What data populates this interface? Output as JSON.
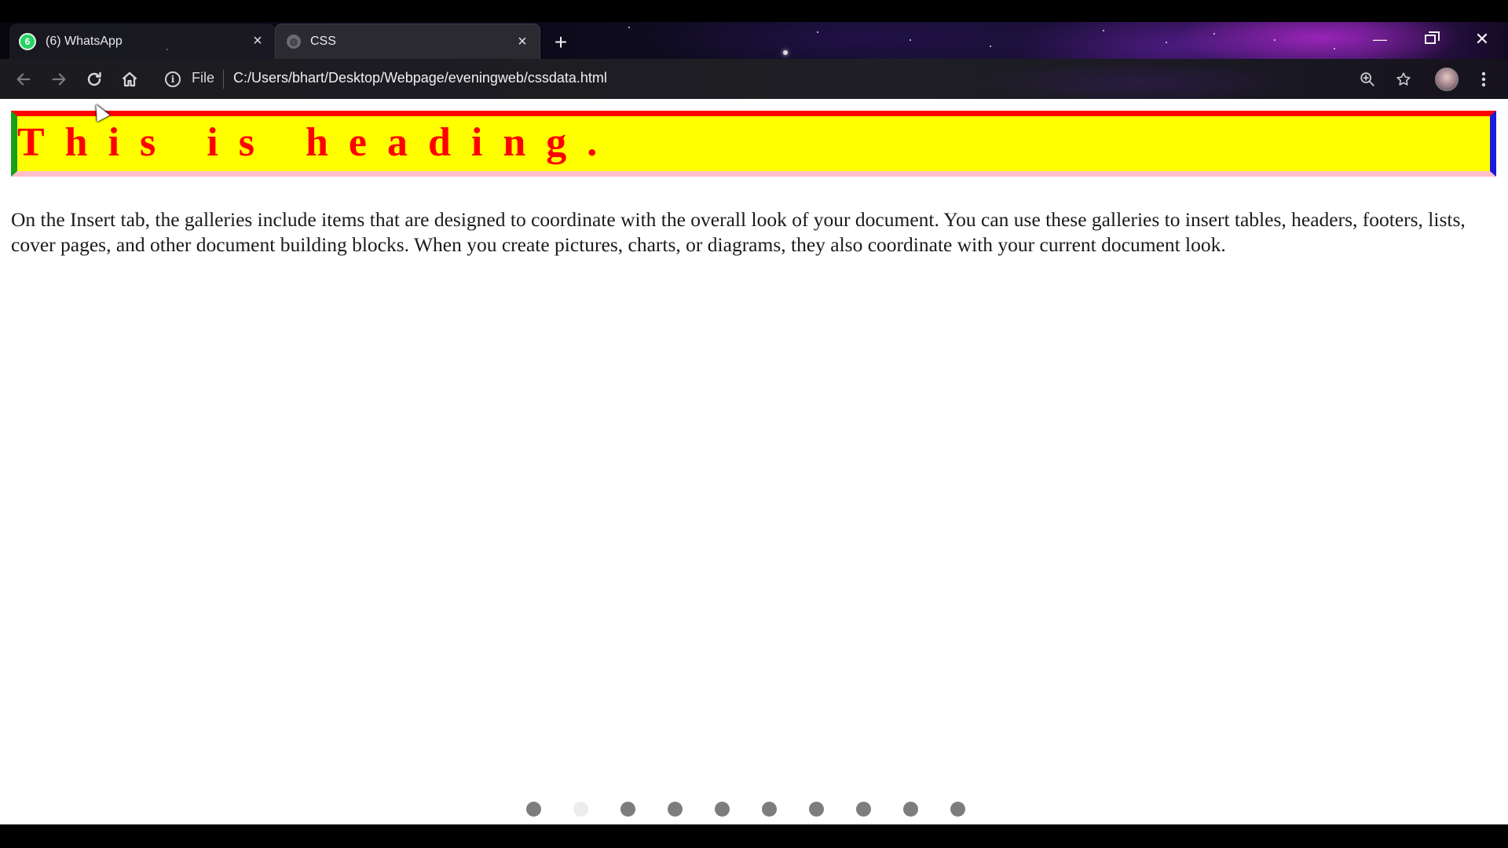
{
  "tabs": [
    {
      "title": "(6) WhatsApp",
      "favicon": "whatsapp-icon",
      "badge": "6"
    },
    {
      "title": "CSS",
      "favicon": "globe-icon"
    }
  ],
  "toolbar": {
    "scheme_label": "File",
    "url": "C:/Users/bhart/Desktop/Webpage/eveningweb/cssdata.html"
  },
  "page": {
    "heading": "This is heading.",
    "paragraph": "On the Insert tab, the galleries include items that are designed to coordinate with the overall look of your document. You can use these galleries to insert tables, headers, footers, lists, cover pages, and other document building blocks. When you create pictures, charts, or diagrams, they also coordinate with your current document look."
  },
  "carousel": {
    "count": 10,
    "active_index": 1
  },
  "colors": {
    "heading_bg": "#ffff00",
    "heading_text": "#ff0000",
    "border_top": "#ff0000",
    "border_left": "#16a016",
    "border_right": "#1a1adf",
    "border_bottom": "#ffc0cb"
  }
}
